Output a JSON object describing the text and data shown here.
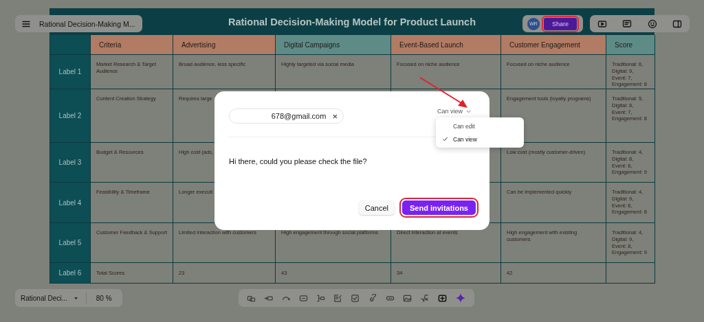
{
  "top_bar": {
    "doc_title": "Rational Decision-Making M...",
    "avatar": "WR",
    "share": {
      "label": "Share",
      "highlighted": true
    }
  },
  "table": {
    "title": "Rational Decision-Making Model for Product Launch",
    "columns": [
      {
        "label": "Criteria",
        "color": "#b27b64"
      },
      {
        "label": "Advertising",
        "color": "#b27b64"
      },
      {
        "label": "Digital Campaigns",
        "color": "#5f8b86"
      },
      {
        "label": "Event-Based Launch",
        "color": "#b27b64"
      },
      {
        "label": "Customer Engagement",
        "color": "#b27b64"
      },
      {
        "label": "Score",
        "color": "#5f8b86"
      }
    ],
    "rows": [
      {
        "label": "Label 1",
        "cells": [
          "Market Research & Target Audience",
          "Broad audience, less specific",
          "Highly targeted via social media",
          "Focused on niche audience",
          "Focused on niche audience",
          "Traditional: 6,\nDigital: 9,\nEvent: 7,\nEngagement: 8"
        ]
      },
      {
        "label": "Label 2",
        "cells": [
          "Content Creation Strategy",
          "Requires large",
          null,
          null,
          "Engagement tools (loyalty programs)",
          "Traditional: 5,\nDigital: 8,\nEvent: 7,\nEngagement: 8"
        ]
      },
      {
        "label": "Label 3",
        "cells": [
          "Budget & Resources",
          "High cost (ads,",
          null,
          null,
          "Low cost (mostly customer-driven)",
          "Traditional: 4,\nDigital: 8,\nEvent: 6,\nEngagement: 9"
        ]
      },
      {
        "label": "Label 4",
        "cells": [
          "Feasibility & Timeframe",
          "Longer executi",
          null,
          null,
          "Can be implemented quickly",
          "Traditional: 4,\nDigital: 9,\nEvent: 6,\nEngagement: 8"
        ]
      },
      {
        "label": "Label 5",
        "cells": [
          "Customer Feedback & Support",
          "Limited interaction with customers",
          "High engagement through social platforms",
          "Direct interaction at events",
          "High engagement with existing customers",
          "Traditional: 4,\nDigital: 9,\nEvent: 8,\nEngagement: 9"
        ]
      },
      {
        "label": "Label 6",
        "cells": [
          "Total Scores",
          "23",
          "43",
          "34",
          "42",
          null
        ]
      }
    ]
  },
  "bottom_bar": {
    "doc_name": "Rational Deci...",
    "zoom": "80 %"
  },
  "dialog": {
    "recipient": "678@gmail.com",
    "remove": "×",
    "permission": "Can view",
    "permission_menu": [
      {
        "label": "Can edit",
        "selected": false
      },
      {
        "label": "Can view",
        "selected": true
      }
    ],
    "message": "Hi there, could you please check the file?",
    "buttons": [
      {
        "label": "Cancel",
        "kind": "secondary",
        "highlighted": false
      },
      {
        "label": "Send invitations",
        "kind": "primary",
        "highlighted": true
      }
    ]
  }
}
